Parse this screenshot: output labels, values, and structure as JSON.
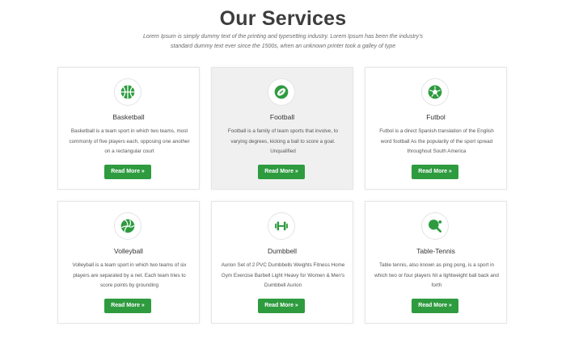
{
  "section": {
    "title": "Our Services",
    "subtitle": "Lorem Ipsum is simply dummy text of the printing and typesetting industry. Lorem Ipsum has been the industry's standard dummy text ever since the 1500s, when an unknown printer took a galley of type"
  },
  "colors": {
    "accent": "#2e9b3f",
    "active_card_bg": "#f0f0f0"
  },
  "cards": [
    {
      "icon": "basketball-icon",
      "title": "Basketball",
      "text": "Basketball is a team sport in which two teams, most commonly of five players each, opposing one another on a rectangular court",
      "button": "Read More »"
    },
    {
      "icon": "football-icon",
      "title": "Football",
      "text": "Football is a family of team sports that involve, to varying degrees, kicking a ball to score a goal. Unqualified",
      "button": "Read More »",
      "active": true
    },
    {
      "icon": "soccer-ball-icon",
      "title": "Futbol",
      "text": "Futbol is a direct Spanish translation of the English word football As the popularity of the sport spread throughout South America",
      "button": "Read More »"
    },
    {
      "icon": "volleyball-icon",
      "title": "Volleyball",
      "text": "Volleyball is a team sport in which two teams of six players are separated by a net. Each team tries to score points by grounding",
      "button": "Read More »"
    },
    {
      "icon": "dumbbell-icon",
      "title": "Dumbbell",
      "text": "Aurion Set of 2 PVC Dumbbells Weights Fitness Home Gym Exercise Barbell Light Heavy for Women & Men's Dumbbell Aurion",
      "button": "Read More »"
    },
    {
      "icon": "table-tennis-icon",
      "title": "Table-Tennis",
      "text": "Table tennis, also known as ping pong, is a sport in which two or four players hit a lightweight ball back and forth",
      "button": "Read More »"
    }
  ]
}
